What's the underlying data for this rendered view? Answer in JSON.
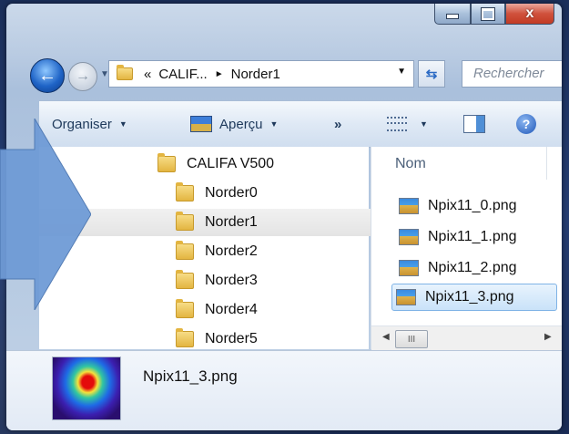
{
  "window": {
    "buttons": {
      "minimize": "minimize",
      "maximize": "maximize",
      "close": "x"
    }
  },
  "address": {
    "chevron": "«",
    "segments": [
      "CALIF...",
      "Norder1"
    ],
    "separator": "►",
    "dropdown": "▼",
    "search_placeholder": "Rechercher"
  },
  "toolbar": {
    "organise_label": "Organiser",
    "preview_label": "Aperçu",
    "more_label": "»",
    "caret": "▼",
    "help_label": "?"
  },
  "tree": {
    "items": [
      {
        "label": "CALIFA V500"
      },
      {
        "label": "Norder0"
      },
      {
        "label": "Norder1"
      },
      {
        "label": "Norder2"
      },
      {
        "label": "Norder3"
      },
      {
        "label": "Norder4"
      },
      {
        "label": "Norder5"
      }
    ],
    "selected_index": 2
  },
  "files": {
    "column_header": "Nom",
    "items": [
      {
        "name": "Npix11_0.png"
      },
      {
        "name": "Npix11_1.png"
      },
      {
        "name": "Npix11_2.png"
      },
      {
        "name": "Npix11_3.png"
      }
    ],
    "selected_index": 3,
    "hscroll_thumb": "III"
  },
  "details": {
    "file_name": "Npix11_3.png"
  },
  "colors": {
    "accent": "#1f64c7",
    "arrow": "#6f9bd6"
  },
  "icons": [
    "back-arrow-icon",
    "forward-arrow-icon",
    "folder-icon",
    "refresh-icon",
    "preview-icon",
    "views-icon",
    "preview-pane-icon",
    "help-icon",
    "png-file-icon"
  ]
}
